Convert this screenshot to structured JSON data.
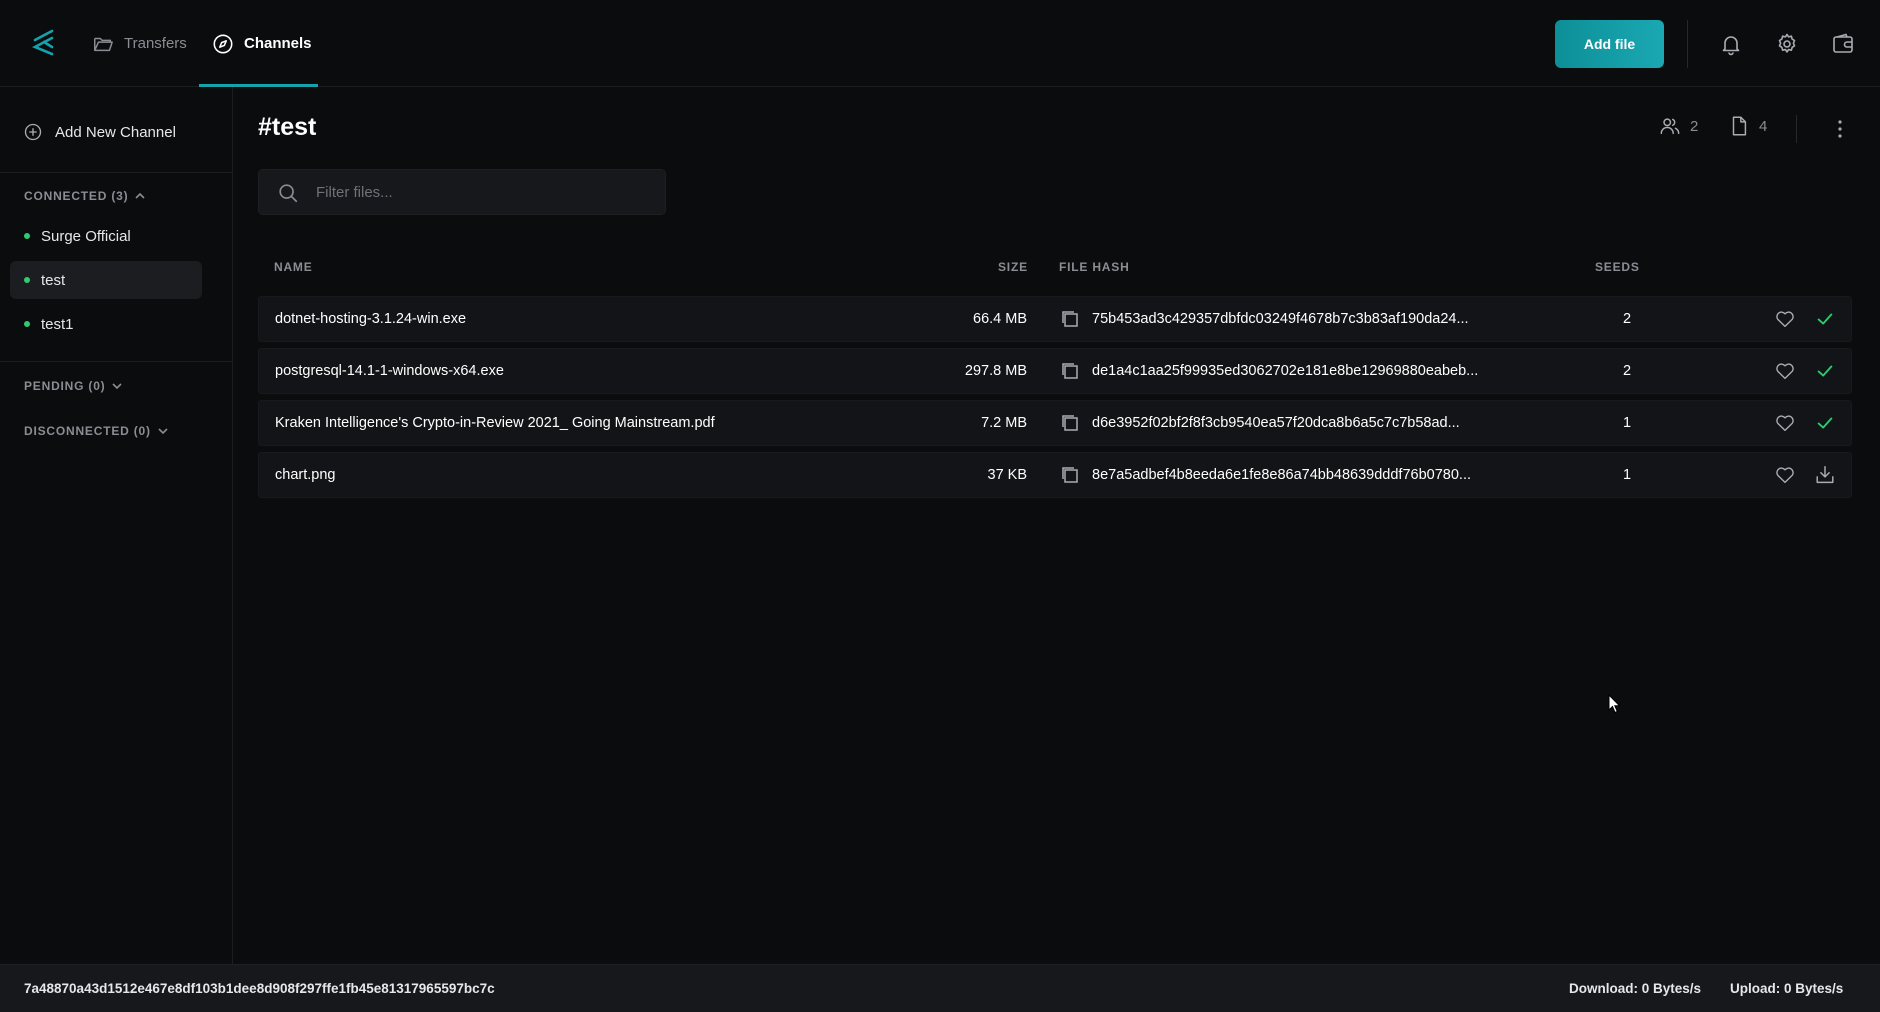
{
  "header": {
    "logo_icon": "surge-logo-icon",
    "tabs": [
      {
        "label": "Transfers",
        "icon": "folder-open-icon",
        "active": false
      },
      {
        "label": "Channels",
        "icon": "compass-icon",
        "active": true
      }
    ],
    "add_file_label": "Add file",
    "icons": [
      "bell-icon",
      "gear-icon",
      "wallet-icon"
    ],
    "accent_color": "#14a3ad"
  },
  "sidebar": {
    "add_channel_label": "Add New Channel",
    "connected_label": "CONNECTED (3)",
    "channels": [
      {
        "label": "Surge Official",
        "active": false
      },
      {
        "label": "test",
        "active": true
      },
      {
        "label": "test1",
        "active": false
      }
    ],
    "pending_label": "PENDING (0)",
    "disconnected_label": "DISCONNECTED (0)",
    "online_color": "#2ecc71"
  },
  "main": {
    "title": "#test",
    "members_count": "2",
    "files_count": "4",
    "filter_placeholder": "Filter files...",
    "columns": {
      "name": "NAME",
      "size": "SIZE",
      "hash": "FILE HASH",
      "seeds": "SEEDS"
    },
    "files": [
      {
        "name": "dotnet-hosting-3.1.24-win.exe",
        "size": "66.4 MB",
        "hash": "75b453ad3c429357dbfdc03249f4678b7c3b83af190da24...",
        "seeds": "2",
        "status": "downloaded"
      },
      {
        "name": "postgresql-14.1-1-windows-x64.exe",
        "size": "297.8 MB",
        "hash": "de1a4c1aa25f99935ed3062702e181e8be12969880eabeb...",
        "seeds": "2",
        "status": "downloaded"
      },
      {
        "name": "Kraken Intelligence's Crypto-in-Review 2021_ Going Mainstream.pdf",
        "size": "7.2 MB",
        "hash": "d6e3952f02bf2f8f3cb9540ea57f20dca8b6a5c7c7b58ad...",
        "seeds": "1",
        "status": "downloaded"
      },
      {
        "name": "chart.png",
        "size": "37 KB",
        "hash": "8e7a5adbef4b8eeda6e1fe8e86a74bb48639dddf76b0780...",
        "seeds": "1",
        "status": "download"
      }
    ]
  },
  "footer": {
    "node_id": "7a48870a43d1512e467e8df103b1dee8d908f297ffe1fb45e81317965597bc7c",
    "download": "Download: 0 Bytes/s",
    "upload": "Upload: 0 Bytes/s"
  }
}
